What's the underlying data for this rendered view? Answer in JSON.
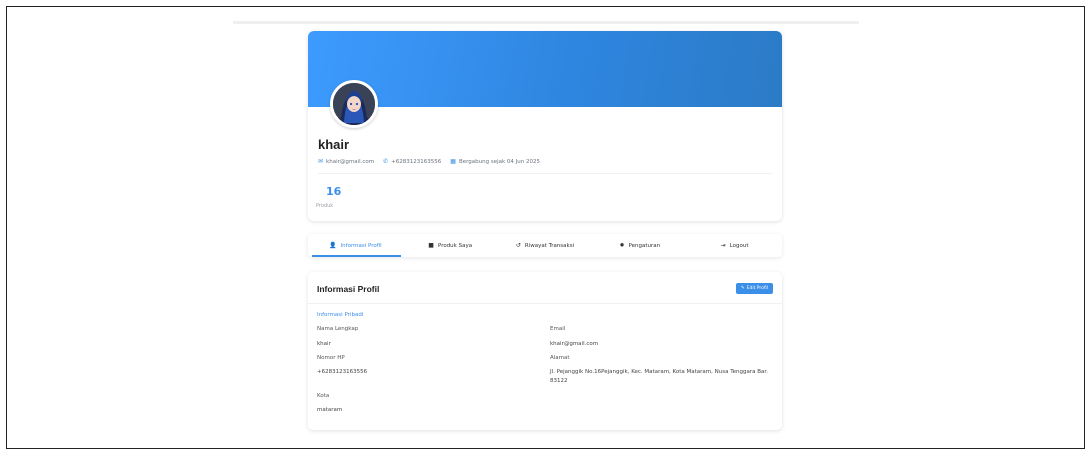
{
  "profile": {
    "username": "khair",
    "email": "khair@gmail.com",
    "phone": "+6283123163556",
    "joined": "Bergabung sejak 04 Jun 2025",
    "stats": {
      "count": "16",
      "label": "Produk"
    }
  },
  "tabs": [
    {
      "label": "Informasi Profil",
      "icon": "user-icon",
      "active": true
    },
    {
      "label": "Produk Saya",
      "icon": "box-icon",
      "active": false
    },
    {
      "label": "Riwayat Transaksi",
      "icon": "history-icon",
      "active": false
    },
    {
      "label": "Pengaturan",
      "icon": "gear-icon",
      "active": false
    },
    {
      "label": "Logout",
      "icon": "logout-icon",
      "active": false
    }
  ],
  "info": {
    "title": "Informasi Profil",
    "edit_label": "Edit Profil",
    "section_title": "Informasi Pribadi",
    "fields": {
      "full_name_label": "Nama Lengkap",
      "full_name_value": "khair",
      "phone_label": "Nomor HP",
      "phone_value": "+6283123163556",
      "city_label": "Kota",
      "city_value": "mataram",
      "email_label": "Email",
      "email_value": "khair@gmail.com",
      "address_label": "Alamat",
      "address_value": "Jl. Pejanggik No.16Pejanggik, Kec. Mataram, Kota Mataram, Nusa Tenggara Bar. 83122"
    }
  },
  "colors": {
    "accent": "#3b8fe8",
    "banner_start": "#3d9bff",
    "banner_end": "#2b7bc6"
  }
}
